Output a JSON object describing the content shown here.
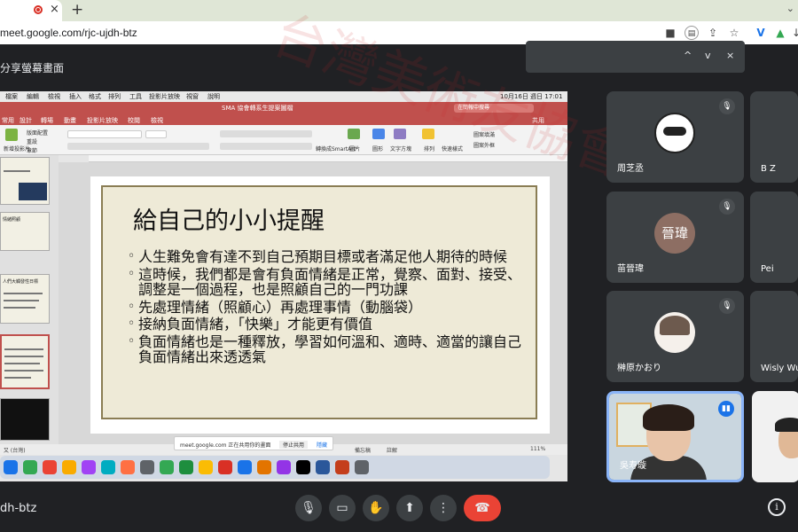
{
  "browser": {
    "tab_close": "×",
    "new_tab": "+",
    "url": "meet.google.com/rjc-ujdh-btz",
    "toolbar_icons": [
      "video-icon",
      "lens-icon",
      "share-icon",
      "star-icon",
      "vpn-icon",
      "drive-icon",
      "download-icon",
      "more-icon"
    ]
  },
  "meet": {
    "presenting_label": "分享螢幕畫面",
    "meeting_code": "dh-btz",
    "notice_controls": [
      "^",
      "v",
      "×"
    ]
  },
  "shared_screen": {
    "mac_menu": [
      "檔案",
      "編輯",
      "檢視",
      "插入",
      "格式",
      "排列",
      "工具",
      "投影片放映",
      "視窗",
      "說明"
    ],
    "mac_clock": "10月16日 週日 17:01",
    "ppt_window_title": "SMA 協會轉系生提案圖檔",
    "ppt_search": "在簡報中搜尋",
    "ppt_tabs": [
      "常用",
      "設計",
      "轉場",
      "動畫",
      "投影片放映",
      "校閱",
      "檢視"
    ],
    "ppt_share": "共用",
    "ribbon_labels": [
      "新增投影片",
      "版面配置",
      "重設",
      "章節",
      "轉換成SmartArt",
      "圖片",
      "圖形",
      "文字方塊",
      "排列",
      "快速樣式",
      "圖案填滿",
      "圖案外框"
    ],
    "thumbnail_titles": [
      "",
      "情緒照顧",
      "人們大觸發性日標",
      "",
      ""
    ],
    "slide": {
      "title": "給自己的小小提醒",
      "bullets": [
        "人生難免會有達不到自己預期目標或者滿足他人期待的時候",
        "這時候，我們都是會有負面情緒是正常，覺察、面對、接受、調整是一個過程，也是照顧自己的一門功課",
        "先處理情緒（照顧心）再處理事情（動腦袋）",
        "接納負面情緒，「快樂」才能更有價值",
        "負面情緒也是一種釋放，學習如何溫和、適時、適當的讓自己負面情緒出來透透氣"
      ]
    },
    "status_left": "又 (台灣)",
    "status_notes": "備忘稿",
    "status_comments": "註解",
    "zoom": "111%",
    "share_bar": {
      "text": "meet.google.com 正在共用你的畫面",
      "stop": "停止共用",
      "hide": "隱藏"
    },
    "dock_colors": [
      "#1a73e8",
      "#34a853",
      "#ea4335",
      "#f9ab00",
      "#a142f4",
      "#00acc1",
      "#ff7043",
      "#5f6368",
      "#34a853",
      "#1e8e3e",
      "#fbbc04",
      "#d93025",
      "#1a73e8",
      "#e37400",
      "#9334e6",
      "#000000",
      "#2b579a",
      "#c43e1c",
      "#5f6368"
    ]
  },
  "participants": [
    {
      "name": "周芝丞",
      "muted": true,
      "avatar": "avatar-cartoon"
    },
    {
      "name": "B Z",
      "muted": true,
      "avatar": ""
    },
    {
      "name": "苗晉瑋",
      "muted": true,
      "avatar_text": "晉瑋",
      "avatar_color": "#8d6e63"
    },
    {
      "name": "Pei",
      "muted": true,
      "avatar": ""
    },
    {
      "name": "榊原かおり",
      "muted": true,
      "avatar": "avatar-illustration"
    },
    {
      "name": "Wisly Wu",
      "muted": true,
      "avatar": ""
    },
    {
      "name": "吳寿璇",
      "muted": false,
      "speaking": true,
      "avatar": "video"
    },
    {
      "name": "",
      "muted": false,
      "avatar": "video"
    }
  ],
  "controls": [
    "mic-icon",
    "camera-icon",
    "raise-hand-icon",
    "present-icon",
    "more-icon",
    "end-call-icon"
  ],
  "controls_glyphs": [
    "🎙",
    "▭",
    "✋",
    "⬆",
    "⋮",
    "☎"
  ],
  "info_glyph": "i",
  "watermark": "台灣美術友協會"
}
